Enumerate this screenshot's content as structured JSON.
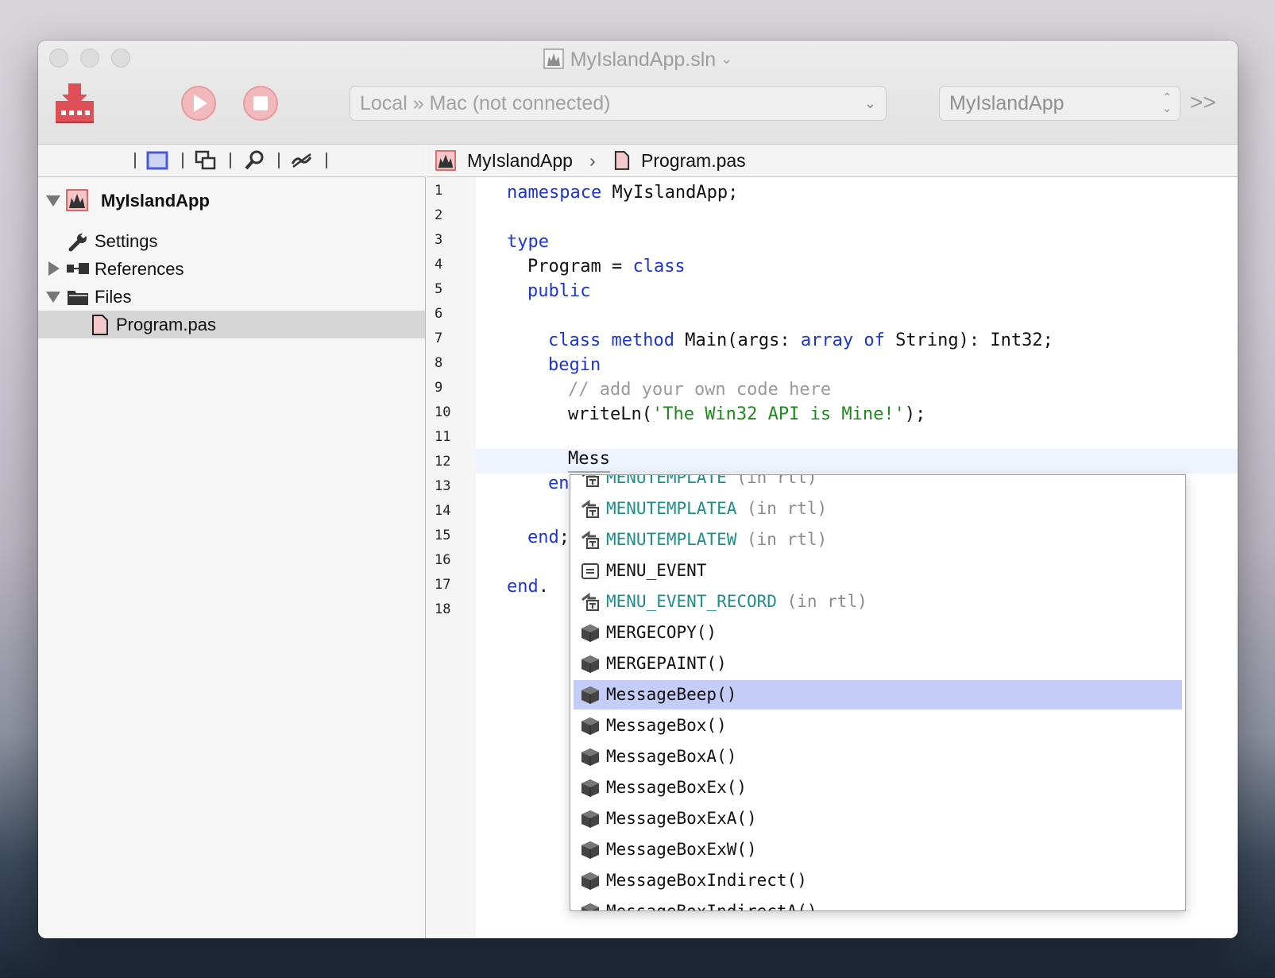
{
  "window": {
    "title": "MyIslandApp.sln"
  },
  "toolbar": {
    "scheme_label": "Local » Mac (not connected)",
    "target_label": "MyIslandApp",
    "overflow": ">>"
  },
  "navigator": {
    "project": "MyIslandApp",
    "items": [
      {
        "label": "Settings"
      },
      {
        "label": "References"
      },
      {
        "label": "Files"
      },
      {
        "label": "Program.pas"
      }
    ]
  },
  "jumpbar": {
    "project": "MyIslandApp",
    "file": "Program.pas"
  },
  "editor": {
    "line_numbers": [
      "1",
      "2",
      "3",
      "4",
      "5",
      "6",
      "7",
      "8",
      "9",
      "10",
      "11",
      "12",
      "13",
      "14",
      "15",
      "16",
      "17",
      "18"
    ],
    "typed": "Mess",
    "line13_fragment": "en"
  },
  "completion": {
    "items": [
      {
        "name": "MENUTEMPLATE",
        "where": "(in rtl)",
        "kind": "type"
      },
      {
        "name": "MENUTEMPLATEA",
        "where": "(in rtl)",
        "kind": "type"
      },
      {
        "name": "MENUTEMPLATEW",
        "where": "(in rtl)",
        "kind": "type"
      },
      {
        "name": "MENU_EVENT",
        "where": "",
        "kind": "const"
      },
      {
        "name": "MENU_EVENT_RECORD",
        "where": "(in rtl)",
        "kind": "type"
      },
      {
        "name": "MERGECOPY()",
        "where": "",
        "kind": "method"
      },
      {
        "name": "MERGEPAINT()",
        "where": "",
        "kind": "method"
      },
      {
        "name": "MessageBeep()",
        "where": "",
        "kind": "method",
        "selected": true
      },
      {
        "name": "MessageBox()",
        "where": "",
        "kind": "method"
      },
      {
        "name": "MessageBoxA()",
        "where": "",
        "kind": "method"
      },
      {
        "name": "MessageBoxEx()",
        "where": "",
        "kind": "method"
      },
      {
        "name": "MessageBoxExA()",
        "where": "",
        "kind": "method"
      },
      {
        "name": "MessageBoxExW()",
        "where": "",
        "kind": "method"
      },
      {
        "name": "MessageBoxIndirect()",
        "where": "",
        "kind": "method"
      },
      {
        "name": "MessageBoxIndirectA()",
        "where": "",
        "kind": "method"
      }
    ]
  },
  "colors": {
    "keyword": "#1b35d8",
    "string": "#1e8a1e",
    "comment": "#9a9a9a",
    "type_completion": "#1e8e8a",
    "selection": "#c3cdf7",
    "app_icon": "#e0575e"
  }
}
